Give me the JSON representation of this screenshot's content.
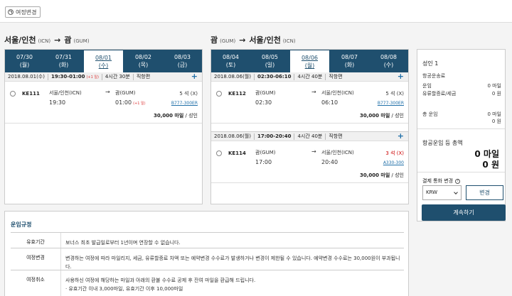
{
  "toolbar": {
    "change_itinerary": "여정변경"
  },
  "outbound": {
    "from": "서울/인천",
    "from_code": "(ICN)",
    "to": "괌",
    "to_code": "(GUM)",
    "dates": [
      {
        "d": "07/30",
        "w": "(월)"
      },
      {
        "d": "07/31",
        "w": "(화)"
      },
      {
        "d": "08/01",
        "w": "(수)"
      },
      {
        "d": "08/02",
        "w": "(목)"
      },
      {
        "d": "08/03",
        "w": "(금)"
      }
    ],
    "flights": [
      {
        "date": "2018.08.01(수)",
        "time": "19:30-01:00",
        "nextday": "(+1 일)",
        "duration": "4시간 30분",
        "type": "직항편",
        "no": "KE111",
        "dep_city": "서울/인천(ICN)",
        "dep_time": "19:30",
        "arr_city": "괌(GUM)",
        "arr_time": "01:00",
        "arr_next": "(+1 일)",
        "seats": "5 석 (X)",
        "aircraft": "B777-300ER",
        "price": "30,000 마일",
        "pax": "/ 성인"
      }
    ]
  },
  "inbound": {
    "from": "괌",
    "from_code": "(GUM)",
    "to": "서울/인천",
    "to_code": "(ICN)",
    "dates": [
      {
        "d": "08/04",
        "w": "(토)"
      },
      {
        "d": "08/05",
        "w": "(일)"
      },
      {
        "d": "08/06",
        "w": "(월)"
      },
      {
        "d": "08/07",
        "w": "(화)"
      },
      {
        "d": "08/08",
        "w": "(수)"
      }
    ],
    "flights": [
      {
        "date": "2018.08.06(월)",
        "time": "02:30-06:10",
        "duration": "4시간 40분",
        "type": "직항편",
        "no": "KE112",
        "dep_city": "괌(GUM)",
        "dep_time": "02:30",
        "arr_city": "서울/인천(ICN)",
        "arr_time": "06:10",
        "seats": "5 석 (X)",
        "aircraft": "B777-300ER",
        "price": "30,000 마일",
        "pax": "/ 성인"
      },
      {
        "date": "2018.08.06(월)",
        "time": "17:00-20:40",
        "duration": "4시간 40분",
        "type": "직항편",
        "no": "KE114",
        "dep_city": "괌(GUM)",
        "dep_time": "17:00",
        "arr_city": "서울/인천(ICN)",
        "arr_time": "20:40",
        "seats": "3 석 (X)",
        "aircraft": "A330-300",
        "price": "30,000 마일",
        "pax": "/ 성인"
      }
    ]
  },
  "summary": {
    "title": "성인 1",
    "subtitle": "항공운송료",
    "fare_label": "운임",
    "fare_value": "0 마일",
    "fuel_label": "유류할증료/세금",
    "fuel_value": "0 원",
    "total_label": "총 운임",
    "total_miles": "0 마일",
    "total_won": "0 원",
    "grand_label": "항공운임 등 총액",
    "grand_miles": "0 마일",
    "grand_won": "0 원",
    "currency_label": "결제 통화 변경",
    "currency_value": "KRW",
    "change_label": "변경",
    "continue_label": "계속하기"
  },
  "rules": {
    "title": "운임규정",
    "rows": [
      {
        "label": "유효기간",
        "text": "보너스 최초 발급일로부터 1년이며 연장할 수 없습니다."
      },
      {
        "label": "여정변경",
        "text": "변경하는 여정에 따라 마일리지, 세금, 유류할증료 차액 또는 예약변경 수수료가 발생하거나 변경이 제한될 수 있습니다. 예약변경 수수료는 30,000원이 부과됩니다."
      },
      {
        "label": "여정취소",
        "text": "사용하신 여정에 해당하는 마일과 아래의 환불 수수료 공제 후 잔여 마일을 환급해 드립니다.",
        "text2": "· 유효기간 이내 3,000마일, 유효기간 이후 10,000마일"
      }
    ]
  }
}
